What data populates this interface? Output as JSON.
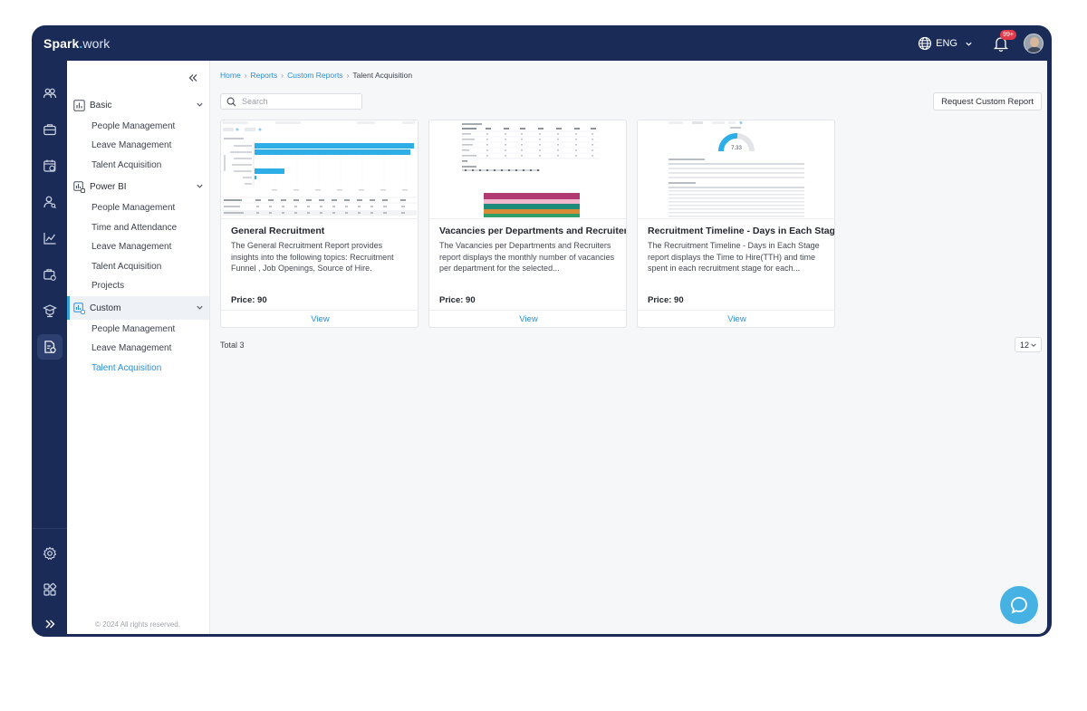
{
  "app": {
    "logo_main": "Spark",
    "logo_dot": ".",
    "logo_suffix": "work",
    "language": "ENG",
    "notification_count": "99+"
  },
  "sidebar": {
    "groups": [
      {
        "label": "Basic",
        "items": [
          "People Management",
          "Leave Management",
          "Talent Acquisition"
        ]
      },
      {
        "label": "Power BI",
        "items": [
          "People Management",
          "Time and Attendance",
          "Leave Management",
          "Talent Acquisition",
          "Projects"
        ]
      },
      {
        "label": "Custom",
        "items": [
          "People Management",
          "Leave Management",
          "Talent Acquisition"
        ]
      }
    ],
    "copyright": "© 2024 All rights reserved."
  },
  "breadcrumb": [
    "Home",
    "Reports",
    "Custom Reports",
    "Talent Acquisition"
  ],
  "search": {
    "placeholder": "Search",
    "value": ""
  },
  "request_button": "Request Custom Report",
  "cards": [
    {
      "title": "General Recruitment",
      "description": "The General Recruitment Report provides insights into the following topics: Recruitment Funnel , Job Openings, Source of Hire.",
      "price": "Price: 90",
      "view": "View"
    },
    {
      "title": "Vacancies per Departments and Recruiters",
      "description": "The Vacancies per Departments and Recruiters report displays the monthly number of vacancies per department for the selected...",
      "price": "Price: 90",
      "view": "View"
    },
    {
      "title": "Recruitment Timeline - Days in Each Stage",
      "description": "The Recruitment Timeline - Days in Each Stage report displays the Time to Hire(TTH) and time spent in each recruitment stage for each...",
      "price": "Price: 90",
      "view": "View",
      "gauge_value": "7.33"
    }
  ],
  "total": "Total 3",
  "page_size": "12",
  "colors": {
    "navy": "#1b2b57",
    "accent": "#2b8fd6",
    "chat": "#46b2e3",
    "badge": "#e23a4a"
  }
}
